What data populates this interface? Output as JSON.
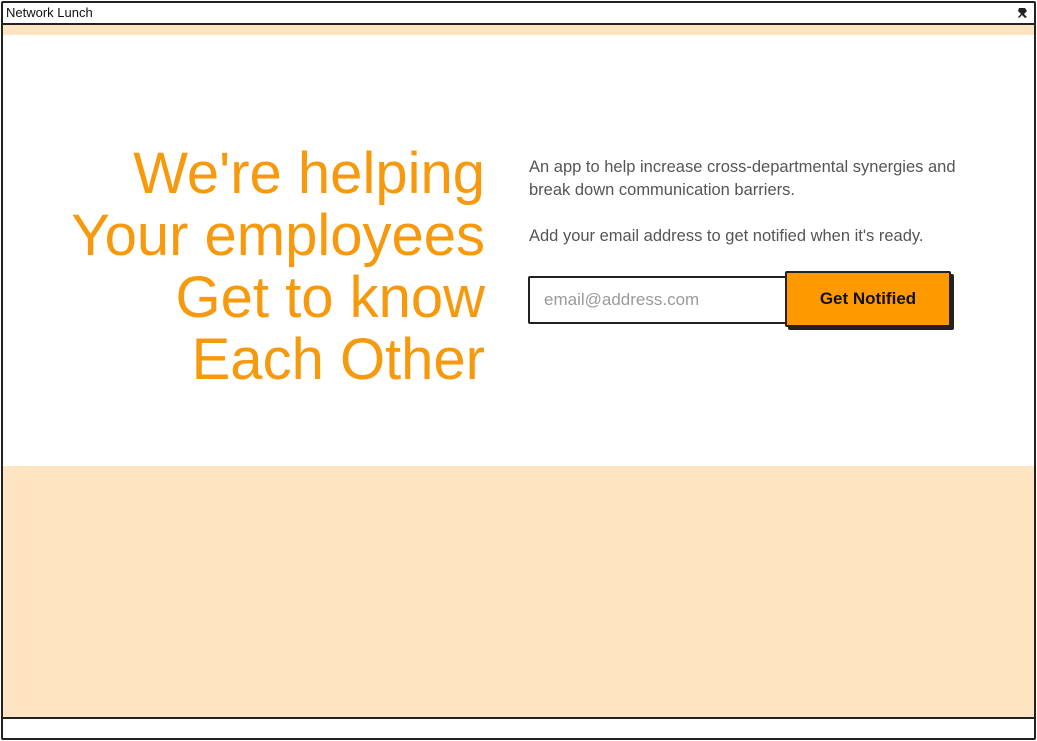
{
  "window": {
    "title": "Network Lunch",
    "pin_icon": "pin-icon"
  },
  "hero": {
    "headline_lines": [
      "We're helping",
      "Your employees",
      "Get to know",
      "Each Other"
    ],
    "description": "An app to help increase cross-departmental synergies and break down communication barriers.",
    "cta_text": "Add your email address to get notified when it's ready."
  },
  "signup": {
    "email_placeholder": "email@address.com",
    "email_value": "",
    "button_label": "Get Notified"
  },
  "colors": {
    "accent": "#f7990d",
    "button": "#fe9a00",
    "band": "#fee4c0",
    "text": "#555555",
    "border": "#222222"
  }
}
